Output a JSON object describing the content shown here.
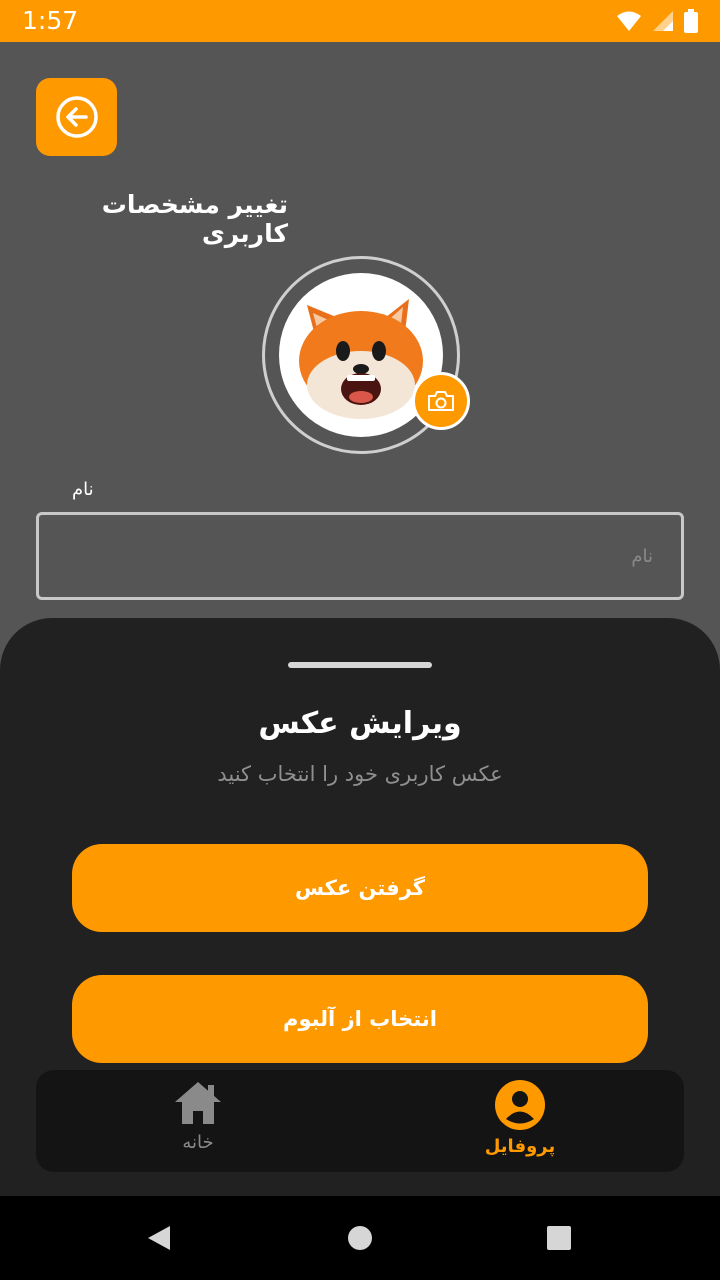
{
  "status_bar": {
    "time": "1:57"
  },
  "header": {
    "title": "تغییر مشخصات کاربری"
  },
  "form": {
    "name_label": "نام",
    "name_value": "",
    "name_placeholder": "نام"
  },
  "sheet": {
    "title": "ویرایش عکس",
    "subtitle": "عکس کاربری خود را انتخاب کنید",
    "take_photo_label": "گرفتن عکس",
    "choose_album_label": "انتخاب از آلبوم"
  },
  "bottom_nav": {
    "home_label": "خانه",
    "profile_label": "پروفایل",
    "active": "profile"
  },
  "colors": {
    "accent": "#FF9900",
    "background": "#555555",
    "sheet": "#212121",
    "nav": "#141414",
    "inactive": "#8a8a8a"
  },
  "icons": [
    "back-arrow-icon",
    "camera-icon",
    "home-icon",
    "profile-icon",
    "wifi-icon",
    "signal-icon",
    "battery-icon",
    "back-triangle-icon",
    "home-circle-icon",
    "recents-square-icon"
  ]
}
